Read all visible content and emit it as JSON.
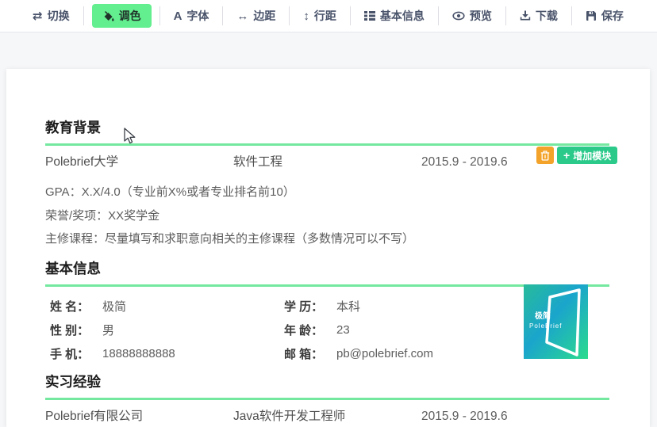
{
  "toolbar": {
    "items": [
      {
        "label": "切换",
        "icon": "switch-icon",
        "glyph": "⇄",
        "active": false
      },
      {
        "label": "调色",
        "icon": "palette-icon",
        "active": true
      },
      {
        "label": "字体",
        "icon": "font-icon",
        "glyph": "A",
        "active": false
      },
      {
        "label": "边距",
        "icon": "margin-icon",
        "glyph": "↔",
        "active": false
      },
      {
        "label": "行距",
        "icon": "line-height-icon",
        "glyph": "↕",
        "active": false
      },
      {
        "label": "基本信息",
        "icon": "basic-info-icon",
        "active": false
      },
      {
        "label": "预览",
        "icon": "preview-icon",
        "active": false
      },
      {
        "label": "下载",
        "icon": "download-icon",
        "active": false
      },
      {
        "label": "保存",
        "icon": "save-icon",
        "active": false
      }
    ]
  },
  "module_actions": {
    "delete_icon": "trash-icon",
    "add_icon_glyph": "+",
    "add_label": "增加模块"
  },
  "resume": {
    "education": {
      "title": "教育背景",
      "entry": {
        "school": "Polebrief大学",
        "major": "软件工程",
        "period": "2015.9 - 2019.6"
      },
      "details": [
        "GPA：X.X/4.0（专业前X%或者专业排名前10）",
        "荣誉/奖项：XX奖学金",
        "主修课程：尽量填写和求职意向相关的主修课程（多数情况可以不写）"
      ]
    },
    "basic_info": {
      "title": "基本信息",
      "fields": [
        {
          "label": "姓 名：",
          "value": "极简"
        },
        {
          "label": "学 历：",
          "value": "本科"
        },
        {
          "label": "性 别：",
          "value": "男"
        },
        {
          "label": "年 龄：",
          "value": "23"
        },
        {
          "label": "手 机：",
          "value": "18888888888"
        },
        {
          "label": "邮 箱：",
          "value": "pb@polebrief.com"
        }
      ],
      "logo_text_cn": "极简",
      "logo_text_en": "PoleBrief"
    },
    "internship": {
      "title": "实习经验",
      "entry": {
        "company": "Polebrief有限公司",
        "role": "Java软件开发工程师",
        "period": "2015.9 - 2019.6"
      }
    }
  },
  "colors": {
    "accent_active_green": "#63ee8f",
    "section_underline_green": "#74e89f",
    "add_button_green": "#2bc98a",
    "delete_button_orange": "#f3a329",
    "toolbar_text": "#49536a",
    "logo_gradient_start": "#28bb9b",
    "logo_gradient_mid": "#1aa5cc",
    "logo_gradient_end": "#2cdb8d"
  }
}
